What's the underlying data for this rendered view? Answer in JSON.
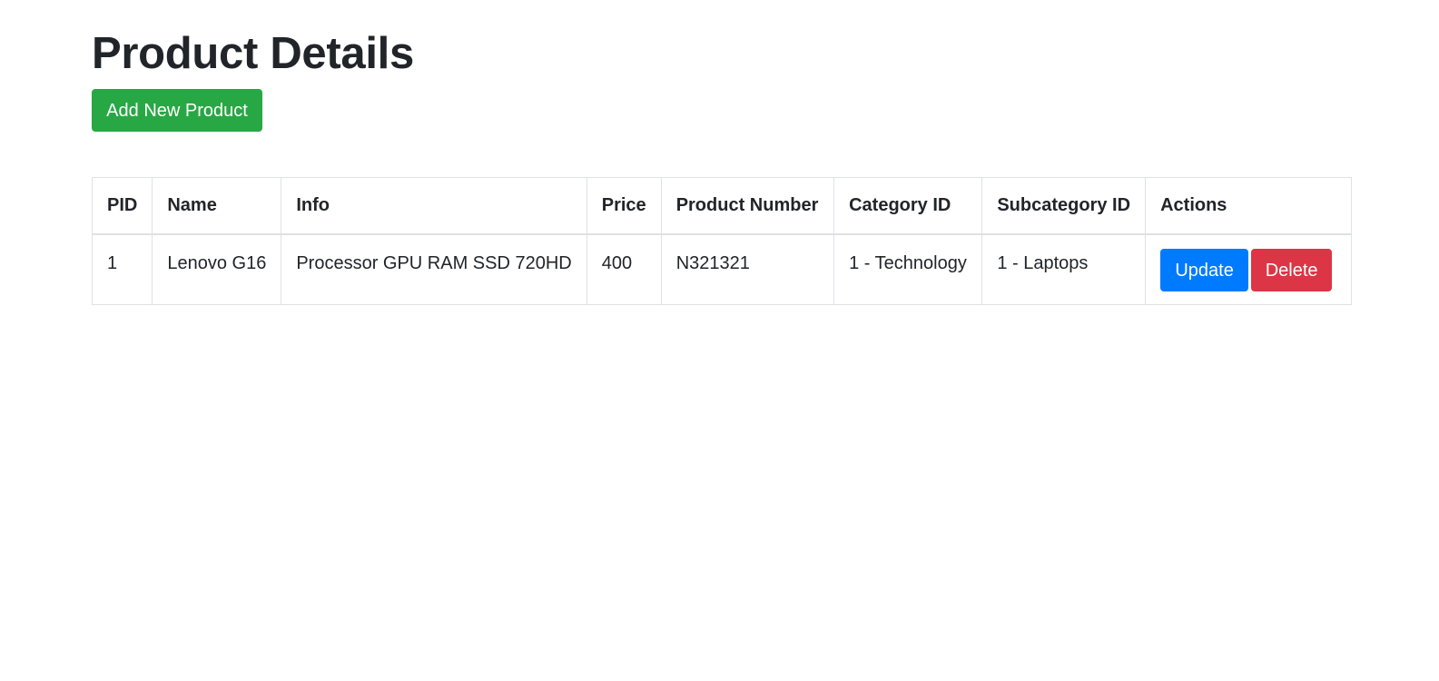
{
  "page": {
    "title": "Product Details",
    "add_button_label": "Add New Product"
  },
  "table": {
    "headers": [
      "PID",
      "Name",
      "Info",
      "Price",
      "Product Number",
      "Category ID",
      "Subcategory ID",
      "Actions"
    ],
    "rows": [
      {
        "pid": "1",
        "name": "Lenovo G16",
        "info": "Processor GPU RAM SSD 720HD",
        "price": "400",
        "product_number": "N321321",
        "category": "1 - Technology",
        "subcategory": "1 - Laptops",
        "update_label": "Update",
        "delete_label": "Delete"
      }
    ]
  },
  "colors": {
    "success": "#28a745",
    "primary": "#007bff",
    "danger": "#dc3545",
    "text": "#212529",
    "border": "#dee2e6"
  }
}
